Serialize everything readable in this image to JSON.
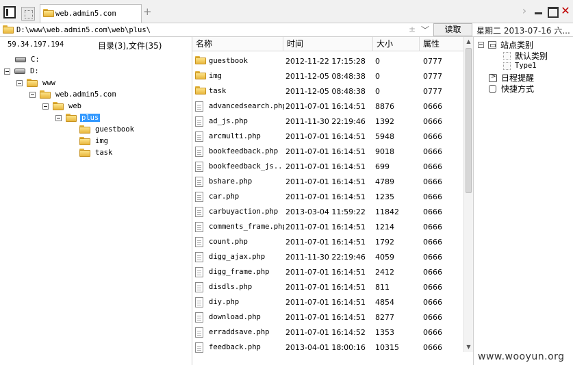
{
  "tabbar": {
    "tab_label": "web.admin5.com"
  },
  "address": {
    "value": "D:\\www\\web.admin5.com\\web\\plus\\",
    "plus": "±",
    "read_button": "读取",
    "date": "星期二 2013-07-16 六..."
  },
  "left": {
    "ip": "59.34.197.194",
    "count": "目录(3),文件(35)",
    "tree": [
      {
        "label": "C:",
        "kind": "drive"
      },
      {
        "label": "D:",
        "kind": "drive"
      },
      {
        "label": "www",
        "kind": "folder"
      },
      {
        "label": "web.admin5.com",
        "kind": "folder"
      },
      {
        "label": "web",
        "kind": "folder"
      },
      {
        "label": "plus",
        "kind": "folder-open"
      },
      {
        "label": "guestbook",
        "kind": "folder"
      },
      {
        "label": "img",
        "kind": "folder"
      },
      {
        "label": "task",
        "kind": "folder"
      }
    ]
  },
  "files": {
    "headers": {
      "name": "名称",
      "time": "时间",
      "size": "大小",
      "attr": "属性"
    },
    "rows": [
      {
        "name": "guestbook",
        "time": "2012-11-22 17:15:28",
        "size": "0",
        "attr": "0777",
        "kind": "folder"
      },
      {
        "name": "img",
        "time": "2011-12-05 08:48:38",
        "size": "0",
        "attr": "0777",
        "kind": "folder"
      },
      {
        "name": "task",
        "time": "2011-12-05 08:48:38",
        "size": "0",
        "attr": "0777",
        "kind": "folder"
      },
      {
        "name": "advancedsearch.php",
        "time": "2011-07-01 16:14:51",
        "size": "8876",
        "attr": "0666",
        "kind": "file"
      },
      {
        "name": "ad_js.php",
        "time": "2011-11-30 22:19:46",
        "size": "1392",
        "attr": "0666",
        "kind": "file"
      },
      {
        "name": "arcmulti.php",
        "time": "2011-07-01 16:14:51",
        "size": "5948",
        "attr": "0666",
        "kind": "file"
      },
      {
        "name": "bookfeedback.php",
        "time": "2011-07-01 16:14:51",
        "size": "9018",
        "attr": "0666",
        "kind": "file"
      },
      {
        "name": "bookfeedback_js...",
        "time": "2011-07-01 16:14:51",
        "size": "699",
        "attr": "0666",
        "kind": "file"
      },
      {
        "name": "bshare.php",
        "time": "2011-07-01 16:14:51",
        "size": "4789",
        "attr": "0666",
        "kind": "file"
      },
      {
        "name": "car.php",
        "time": "2011-07-01 16:14:51",
        "size": "1235",
        "attr": "0666",
        "kind": "file"
      },
      {
        "name": "carbuyaction.php",
        "time": "2013-03-04 11:59:22",
        "size": "11842",
        "attr": "0666",
        "kind": "file"
      },
      {
        "name": "comments_frame.php",
        "time": "2011-07-01 16:14:51",
        "size": "1214",
        "attr": "0666",
        "kind": "file"
      },
      {
        "name": "count.php",
        "time": "2011-07-01 16:14:51",
        "size": "1792",
        "attr": "0666",
        "kind": "file"
      },
      {
        "name": "digg_ajax.php",
        "time": "2011-11-30 22:19:46",
        "size": "4059",
        "attr": "0666",
        "kind": "file"
      },
      {
        "name": "digg_frame.php",
        "time": "2011-07-01 16:14:51",
        "size": "2412",
        "attr": "0666",
        "kind": "file"
      },
      {
        "name": "disdls.php",
        "time": "2011-07-01 16:14:51",
        "size": "811",
        "attr": "0666",
        "kind": "file"
      },
      {
        "name": "diy.php",
        "time": "2011-07-01 16:14:51",
        "size": "4854",
        "attr": "0666",
        "kind": "file"
      },
      {
        "name": "download.php",
        "time": "2011-07-01 16:14:51",
        "size": "8277",
        "attr": "0666",
        "kind": "file"
      },
      {
        "name": "erraddsave.php",
        "time": "2011-07-01 16:14:52",
        "size": "1353",
        "attr": "0666",
        "kind": "file"
      },
      {
        "name": "feedback.php",
        "time": "2013-04-01 18:00:16",
        "size": "10315",
        "attr": "0666",
        "kind": "file"
      }
    ]
  },
  "right": {
    "site_category": "站点类别",
    "default_category": "默认类别",
    "type1": "Type1",
    "reminder": "日程提醒",
    "shortcut": "快捷方式"
  },
  "watermark": "www.wooyun.org",
  "icons": {
    "panel": "panel-toggle-icon",
    "folder": "folder-icon",
    "file": "file-icon",
    "drive": "drive-icon"
  }
}
